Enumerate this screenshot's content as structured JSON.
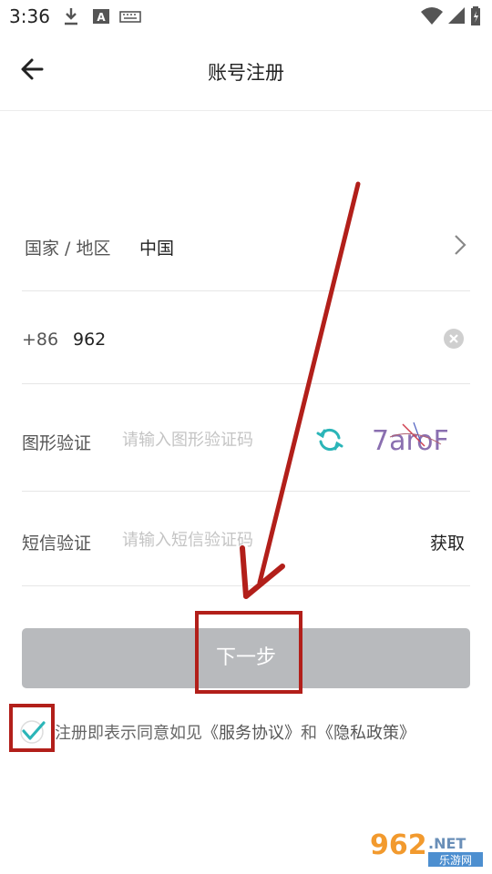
{
  "status_bar": {
    "time": "3:36",
    "icons": [
      "download-icon",
      "keyboard-indicator-icon",
      "keyboard-icon",
      "wifi-icon",
      "signal-icon",
      "battery-icon"
    ]
  },
  "header": {
    "title": "账号注册",
    "back_icon": "arrow-left-icon"
  },
  "form": {
    "country": {
      "label": "国家 / 地区",
      "value": "中国",
      "icon": "chevron-right-icon"
    },
    "phone": {
      "prefix": "+86",
      "value": "962",
      "clear_icon": "clear-icon"
    },
    "captcha": {
      "label": "图形验证",
      "placeholder": "请输入图形验证码",
      "refresh_icon": "refresh-icon",
      "image_text": "7aroF"
    },
    "sms": {
      "label": "短信验证",
      "placeholder": "请输入短信验证码",
      "get_label": "获取"
    }
  },
  "next_button": {
    "label": "下一步"
  },
  "agreement": {
    "checked": true,
    "prefix": "注册即表示同意如见",
    "terms": "《服务协议》",
    "and": "和",
    "privacy": "《隐私政策》"
  },
  "watermark": {
    "brand": "962",
    "domain": ".NET",
    "cn": "乐游网"
  },
  "colors": {
    "accent": "#2bb5b8",
    "annotation_red": "#b21f1a",
    "button_disabled": "#b8babd",
    "divider": "#e6e6e6"
  }
}
